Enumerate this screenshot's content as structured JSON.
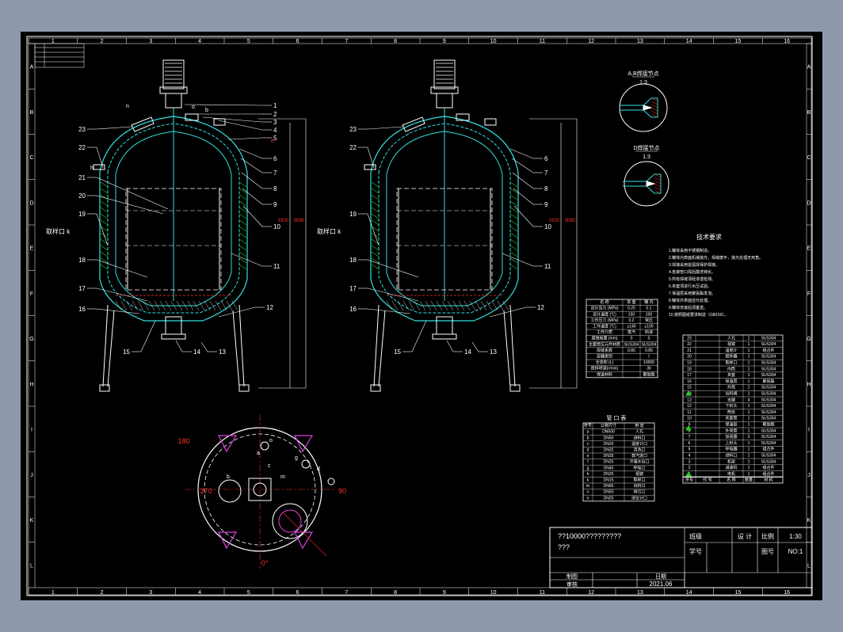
{
  "drawing": {
    "col_numbers": [
      "1",
      "2",
      "3",
      "4",
      "5",
      "6",
      "7",
      "8",
      "9",
      "10",
      "11",
      "12",
      "13",
      "14",
      "15",
      "16"
    ],
    "row_letters": [
      "A",
      "B",
      "C",
      "D",
      "E",
      "F",
      "G",
      "H",
      "I",
      "J",
      "K",
      "L"
    ],
    "left_view_labels": [
      "1",
      "2",
      "3",
      "4",
      "5",
      "6",
      "7",
      "8",
      "9",
      "10",
      "11",
      "12",
      "13",
      "14",
      "15",
      "16",
      "17",
      "18",
      "19",
      "20",
      "21",
      "22",
      "23"
    ],
    "right_view_labels": [
      "6",
      "7",
      "8",
      "9",
      "10",
      "11",
      "12",
      "13",
      "14",
      "15",
      "16",
      "17",
      "18",
      "19",
      "22",
      "23"
    ],
    "side_label": "取样口 k",
    "nozzle_letters": {
      "n": "n",
      "o": "o",
      "b": "b",
      "e": "e",
      "h": "h"
    },
    "dimensions": {
      "height1": "1500",
      "height2": "3090"
    },
    "detail_ab_title": "A,B焊接节点",
    "detail_ab_scale": "1:3",
    "detail_d_title": "D焊接节点",
    "detail_d_scale": "1:3",
    "plan_angles": {
      "a180": "180",
      "a270": "270",
      "a90": "90",
      "a0": "0°"
    },
    "plan_letters": [
      "a",
      "b",
      "c",
      "d",
      "g",
      "m",
      "o"
    ],
    "tech_title": "技术要求",
    "tech_lines": [
      "1.罐体采用不锈钢制造。",
      "2.罐体内表面机械抛光，焊缝磨平，抛光处理无死角。",
      "3.焊接采用氩弧焊保护焊接。",
      "4.各接管口焊后酸洗钝化。",
      "5.所有焊缝须经渗透检测。",
      "6.夹套须进行水压试验。",
      "7.保温层采用聚氨酯发泡。",
      "8.罐体外表面亚光处理。",
      "9.罐体安装后须垂直。",
      "10.按照图纸要求制造（GB150）。"
    ],
    "spec_header": [
      "名 称",
      "夹 套",
      "罐 内"
    ],
    "spec_rows": [
      [
        "设计压力 (MPa)",
        "0.25",
        "0.1"
      ],
      [
        "设计温度 (℃)",
        "150",
        "100"
      ],
      [
        "工作压力 (MPa)",
        "0.2",
        "常压"
      ],
      [
        "工作温度 (℃)",
        "≤140",
        "≤100"
      ],
      [
        "工作介质",
        "蒸汽",
        "料液"
      ],
      [
        "腐蚀裕量 (mm)",
        "0",
        "0"
      ],
      [
        "主要受压元件材质",
        "SUS304",
        "SUS304"
      ],
      [
        "焊缝系数",
        "0.85",
        "0.85"
      ],
      [
        "容器类别",
        "",
        "I"
      ],
      [
        "全容积 (L)",
        "",
        "10000"
      ],
      [
        "搅拌转速(r/min)",
        "",
        "36"
      ],
      [
        "保温材料",
        "",
        "聚氨酯"
      ]
    ],
    "nozzle_title": "管 口 表",
    "nozzle_header": [
      "符号",
      "公称尺寸",
      "用 途"
    ],
    "nozzle_rows": [
      [
        "a",
        "DN500",
        "人孔"
      ],
      [
        "b",
        "DN50",
        "进料口"
      ],
      [
        "c",
        "DN25",
        "温度计口"
      ],
      [
        "d",
        "DN32",
        "清洗口"
      ],
      [
        "e",
        "DN25",
        "蒸汽进口"
      ],
      [
        "f",
        "DN25",
        "冷凝水出口"
      ],
      [
        "g",
        "DN40",
        "呼吸口"
      ],
      [
        "h",
        "DN25",
        "视镜"
      ],
      [
        "k",
        "DN15",
        "取样口"
      ],
      [
        "m",
        "DN65",
        "出料口"
      ],
      [
        "n",
        "DN50",
        "排污口"
      ],
      [
        "o",
        "DN25",
        "液位计口"
      ]
    ],
    "parts_header": [
      "序号",
      "代 号",
      "名 称",
      "数量",
      "材 料"
    ],
    "parts_rows": [
      [
        "23",
        "",
        "人孔",
        "1",
        "SUS304"
      ],
      [
        "22",
        "",
        "视镜",
        "1",
        "SUS304"
      ],
      [
        "21",
        "",
        "温度计",
        "1",
        "组合件"
      ],
      [
        "20",
        "",
        "搅拌器",
        "1",
        "SUS304"
      ],
      [
        "19",
        "",
        "取样口",
        "1",
        "SUS304"
      ],
      [
        "18",
        "",
        "内筒",
        "1",
        "SUS304"
      ],
      [
        "17",
        "",
        "夹套",
        "1",
        "SUS304"
      ],
      [
        "16",
        "",
        "保温层",
        "1",
        "聚氨酯"
      ],
      [
        "15",
        "",
        "外壳",
        "1",
        "SUS304"
      ],
      [
        "14",
        "",
        "出料阀",
        "1",
        "SUS304"
      ],
      [
        "13",
        "",
        "支腿",
        "4",
        "SUS304"
      ],
      [
        "12",
        "",
        "下封头",
        "1",
        "SUS304"
      ],
      [
        "11",
        "",
        "筒体",
        "1",
        "SUS304"
      ],
      [
        "10",
        "",
        "夹套筒",
        "1",
        "SUS304"
      ],
      [
        "9",
        "",
        "保温层",
        "1",
        "聚氨酯"
      ],
      [
        "8",
        "",
        "外壳筒",
        "1",
        "SUS304"
      ],
      [
        "7",
        "",
        "加强圈",
        "2",
        "SUS304"
      ],
      [
        "6",
        "",
        "上封头",
        "1",
        "SUS304"
      ],
      [
        "5",
        "",
        "呼吸器",
        "1",
        "组合件"
      ],
      [
        "4",
        "",
        "进料口",
        "1",
        "SUS304"
      ],
      [
        "3",
        "",
        "机架",
        "1",
        "SUS304"
      ],
      [
        "2",
        "",
        "减速机",
        "1",
        "组合件"
      ],
      [
        "1",
        "",
        "电机",
        "1",
        "组合件"
      ]
    ],
    "title_main": "??10000?????????",
    "title_sub": "???",
    "tb_class": "班级",
    "tb_name_label": "设 计",
    "tb_scale_label": "比例",
    "tb_scale": "1:30",
    "tb_no_label": "学号",
    "tb_sheet_label": "图号",
    "tb_sheet": "NO:1",
    "tb_draw": "制图",
    "tb_check": "审核",
    "tb_date_label": "日期",
    "tb_date": "2021.06"
  }
}
